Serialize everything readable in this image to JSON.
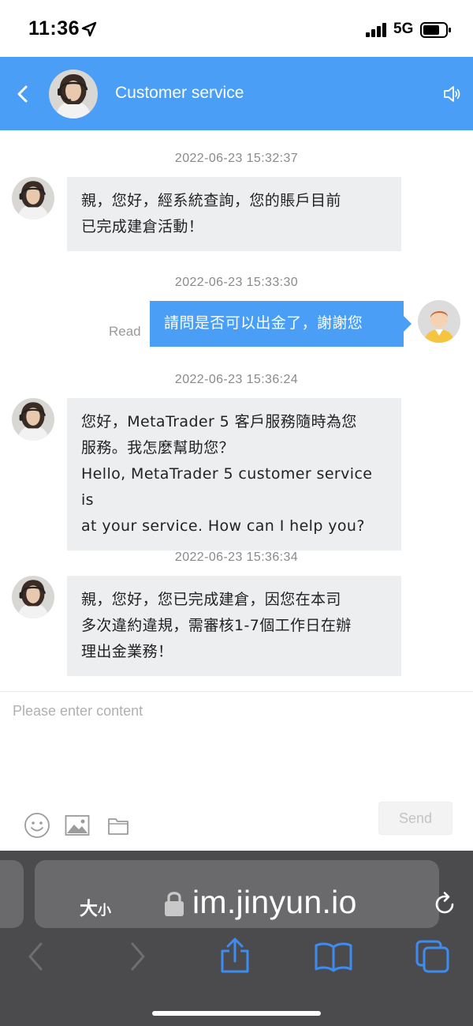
{
  "status_bar": {
    "time": "11:36",
    "network": "5G"
  },
  "header": {
    "title": "Customer service",
    "color": "#4a9ef5"
  },
  "chat": {
    "messages": [
      {
        "timestamp": "2022-06-23 15:32:37",
        "sender": "agent",
        "lines": [
          "親，您好，經系統查詢，您的賬戶目前",
          "已完成建倉活動！"
        ]
      },
      {
        "timestamp": "2022-06-23 15:33:30",
        "sender": "user",
        "status": "Read",
        "lines": [
          "請問是否可以出金了，謝謝您"
        ]
      },
      {
        "timestamp": "2022-06-23 15:36:24",
        "sender": "agent",
        "lines": [
          "您好，MetaTrader 5 客戶服務隨時為您",
          "服務。我怎麼幫助您？",
          "Hello, MetaTrader 5 customer service is",
          "at your service. How can I help you?"
        ]
      },
      {
        "timestamp": "2022-06-23 15:36:34",
        "sender": "agent",
        "lines": [
          "親，您好，您已完成建倉，因您在本司",
          "多次違約違規，需審核1-7個工作日在辦",
          "理出金業務！"
        ]
      }
    ]
  },
  "composer": {
    "placeholder": "Please enter content",
    "value": "",
    "send_label": "Send",
    "tools": [
      "emoji-icon",
      "image-icon",
      "folder-icon"
    ]
  },
  "browser": {
    "aa_big": "大",
    "aa_small": "小",
    "url": "im.jinyun.io",
    "icons": [
      "lock-icon",
      "reload-icon",
      "back-arrow-icon",
      "forward-arrow-icon",
      "share-icon",
      "bookmarks-icon",
      "tabs-icon"
    ]
  }
}
